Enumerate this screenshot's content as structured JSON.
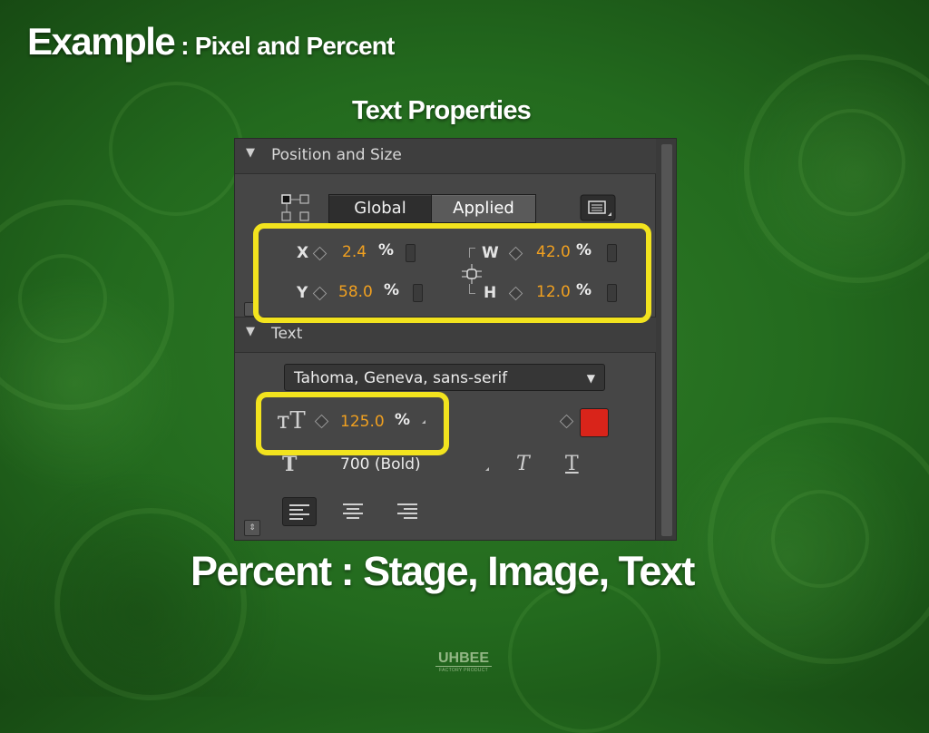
{
  "slide": {
    "title": "Example",
    "title_suffix": " : Pixel and Percent",
    "subtitle": "Text Properties",
    "caption": "Percent : Stage, Image, Text",
    "logo_main": "UHBEE",
    "logo_sub": "FACTORY PRODUCT"
  },
  "panel": {
    "position_section": {
      "label": "Position and Size",
      "global_button": "Global",
      "applied_button": "Applied",
      "x_label": "X",
      "x_value": "2.4",
      "x_unit": "%",
      "y_label": "Y",
      "y_value": "58.0",
      "y_unit": "%",
      "w_label": "W",
      "w_value": "42.0",
      "w_unit": "%",
      "h_label": "H",
      "h_value": "12.0",
      "h_unit": "%"
    },
    "text_section": {
      "label": "Text",
      "font_family": "Tahoma, Geneva, sans-serif",
      "font_size_value": "125.0",
      "font_size_unit": "%",
      "font_weight": "700 (Bold)",
      "text_color": "#d9241a"
    }
  },
  "colors": {
    "highlight": "#f2e31e",
    "value_orange": "#f0a020",
    "background_green": "#236a1e"
  },
  "icons": [
    "collapse-arrow-icon",
    "anchor-grid-icon",
    "panel-menu-icon",
    "link-proportions-icon",
    "font-size-icon",
    "font-weight-icon",
    "italic-icon",
    "underline-icon",
    "align-left-icon",
    "align-center-icon",
    "align-right-icon"
  ]
}
